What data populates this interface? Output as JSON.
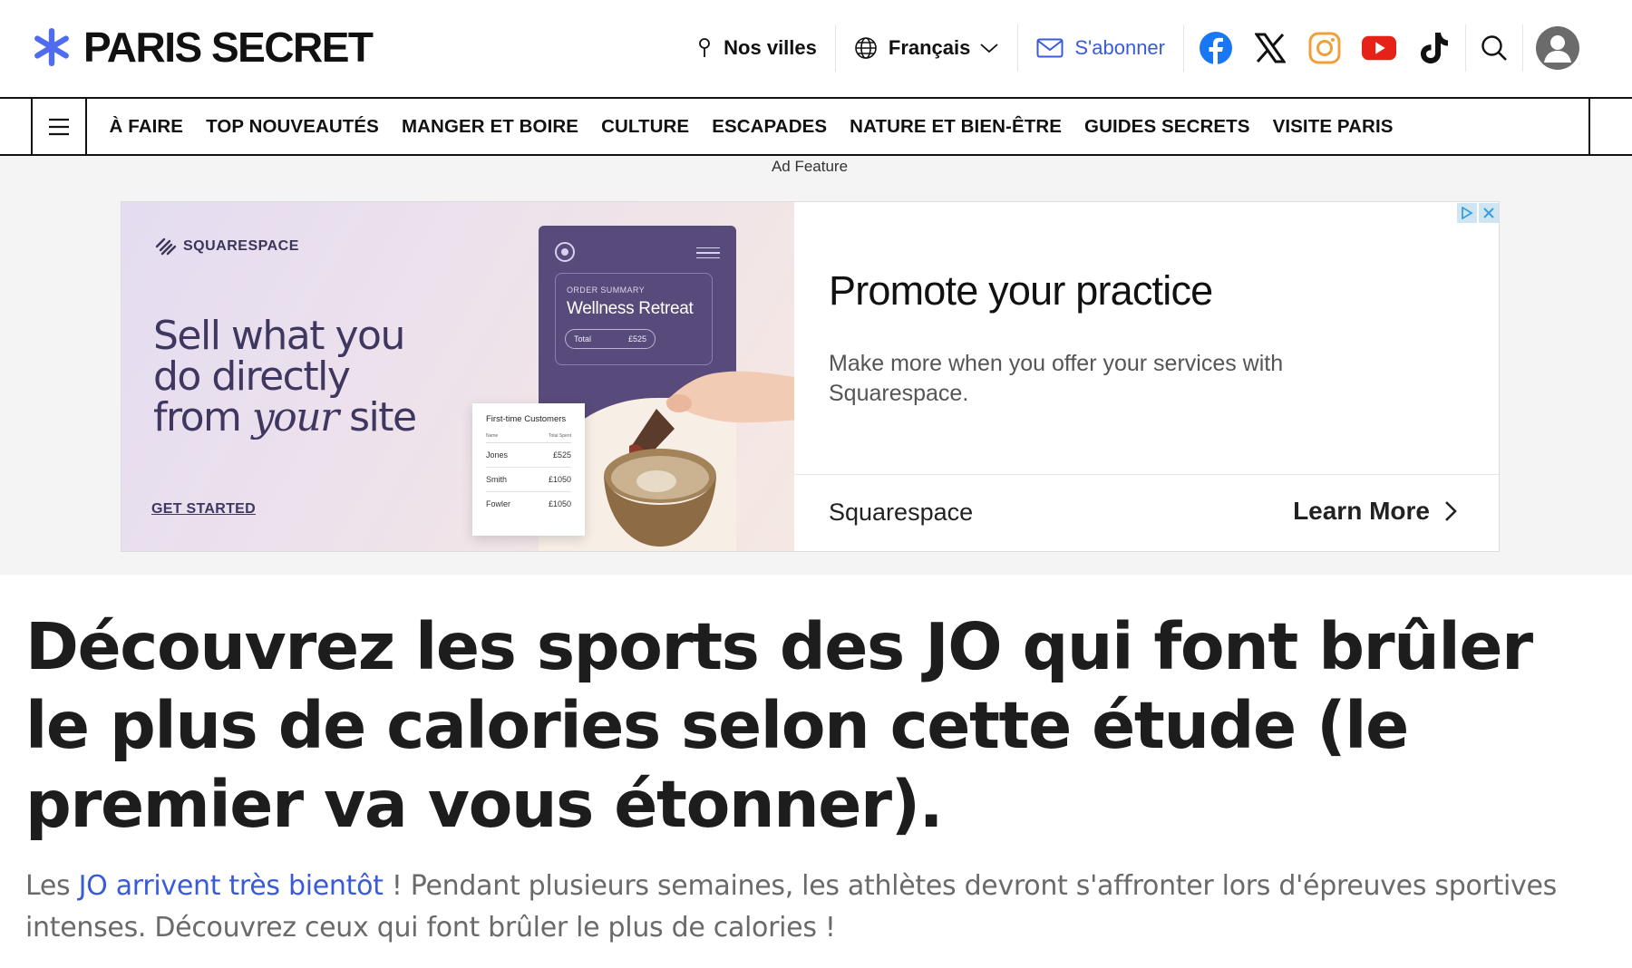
{
  "brand": {
    "name": "PARIS SECRET",
    "accent_color": "#3a5bd9",
    "star_color": "#4f6bf0"
  },
  "header": {
    "cities_label": "Nos villes",
    "language_label": "Français",
    "subscribe_label": "S'abonner",
    "socials": [
      "facebook-icon",
      "x-icon",
      "instagram-icon",
      "youtube-icon",
      "tiktok-icon"
    ]
  },
  "nav": {
    "items": [
      "À FAIRE",
      "TOP NOUVEAUTÉS",
      "MANGER ET BOIRE",
      "CULTURE",
      "ESCAPADES",
      "NATURE ET BIEN-ÊTRE",
      "GUIDES SECRETS",
      "VISITE PARIS"
    ]
  },
  "ad": {
    "label": "Ad Feature",
    "visual": {
      "logo": "SQUARESPACE",
      "headline_1": "Sell what you",
      "headline_2": "do directly",
      "headline_3a": "from ",
      "headline_3b": "your",
      "headline_3c": " site",
      "cta": "GET STARTED",
      "order_label": "ORDER SUMMARY",
      "order_title": "Wellness Retreat",
      "order_total_label": "Total",
      "order_total_value": "£525",
      "customers_title": "First-time Customers",
      "customers_col_name": "Name",
      "customers_col_spent": "Total Spent",
      "customers": [
        {
          "name": "Jones",
          "amount": "£525"
        },
        {
          "name": "Smith",
          "amount": "£1050"
        },
        {
          "name": "Fowler",
          "amount": "£1050"
        }
      ]
    },
    "title": "Promote your practice",
    "description": "Make more when you offer your services with Squarespace.",
    "advertiser": "Squarespace",
    "cta": "Learn More"
  },
  "article": {
    "title": "Découvrez les sports des JO qui font brûler le plus de calories selon cette étude (le premier va vous étonner).",
    "intro_before": "Les ",
    "intro_link": "JO arrivent très bientôt",
    "intro_after": " ! Pendant plusieurs semaines, les athlètes devront s'affronter lors d'épreuves sportives intenses. Découvrez ceux qui font brûler le plus de calories !"
  }
}
